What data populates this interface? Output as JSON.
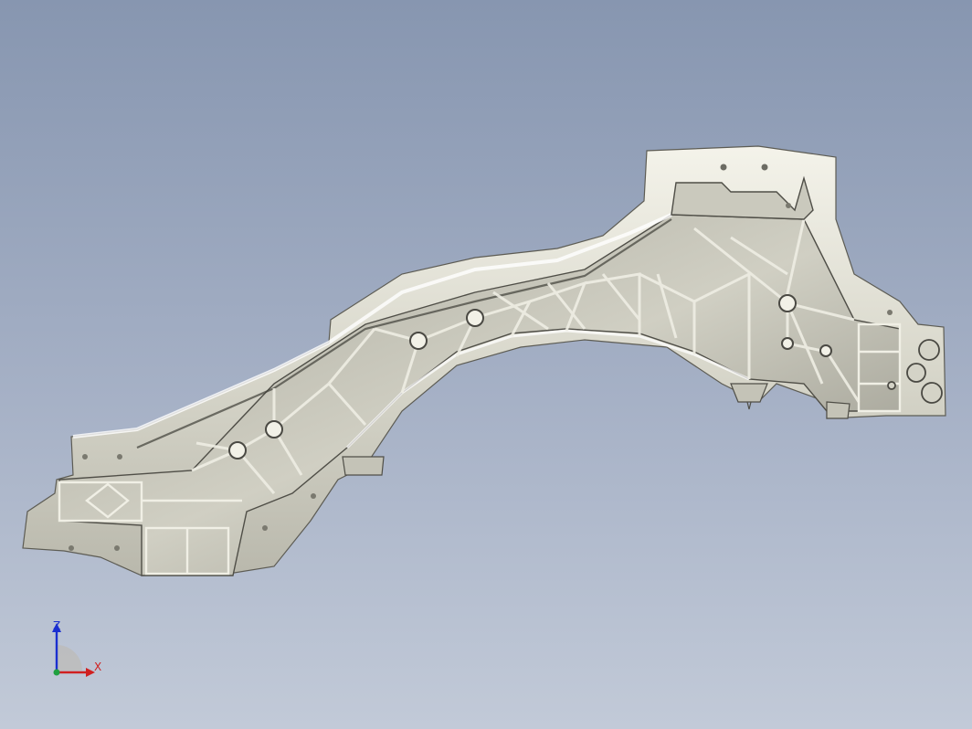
{
  "viewport": {
    "background_top": "#8796b0",
    "background_bottom": "#c2cad8"
  },
  "model": {
    "part": "cast-aluminum-frame-rail",
    "fill_color": "#d9d8cc",
    "web_color": "#b6b5a8",
    "shadow_color": "#6e6d64",
    "highlight_color": "#f4f3ea"
  },
  "triad": {
    "z_label": "Z",
    "x_label": "X",
    "z_color": "#1a2fd0",
    "x_color": "#d02020",
    "y_color": "#20a040",
    "plane_color": "#bcbcbc"
  }
}
